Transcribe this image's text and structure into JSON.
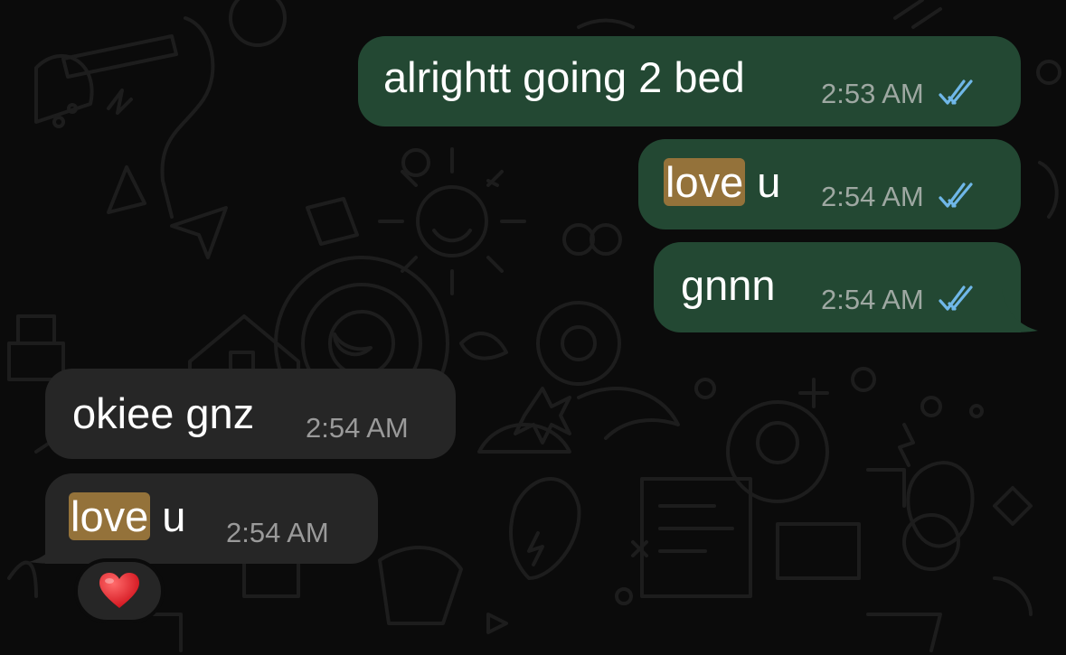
{
  "messages": [
    {
      "direction": "outgoing",
      "parts": [
        {
          "text": "alrightt going 2 bed",
          "highlight": false
        }
      ],
      "time": "2:53 AM",
      "status_icon": "double-check-read-icon"
    },
    {
      "direction": "outgoing",
      "parts": [
        {
          "text": "love",
          "highlight": true
        },
        {
          "text": " u",
          "highlight": false
        }
      ],
      "time": "2:54 AM",
      "status_icon": "double-check-read-icon"
    },
    {
      "direction": "outgoing",
      "parts": [
        {
          "text": "gnnn",
          "highlight": false
        }
      ],
      "time": "2:54 AM",
      "status_icon": "double-check-read-icon"
    },
    {
      "direction": "incoming",
      "parts": [
        {
          "text": "okiee gnz",
          "highlight": false
        }
      ],
      "time": "2:54 AM"
    },
    {
      "direction": "incoming",
      "parts": [
        {
          "text": "love",
          "highlight": true
        },
        {
          "text": " u",
          "highlight": false
        }
      ],
      "time": "2:54 AM",
      "reaction": "heart-emoji"
    }
  ],
  "colors": {
    "outgoing_bubble": "#234833",
    "incoming_bubble": "#262626",
    "highlight": "#94723a",
    "read_ticks": "#6fb7e8",
    "background": "#0b0b0b"
  }
}
